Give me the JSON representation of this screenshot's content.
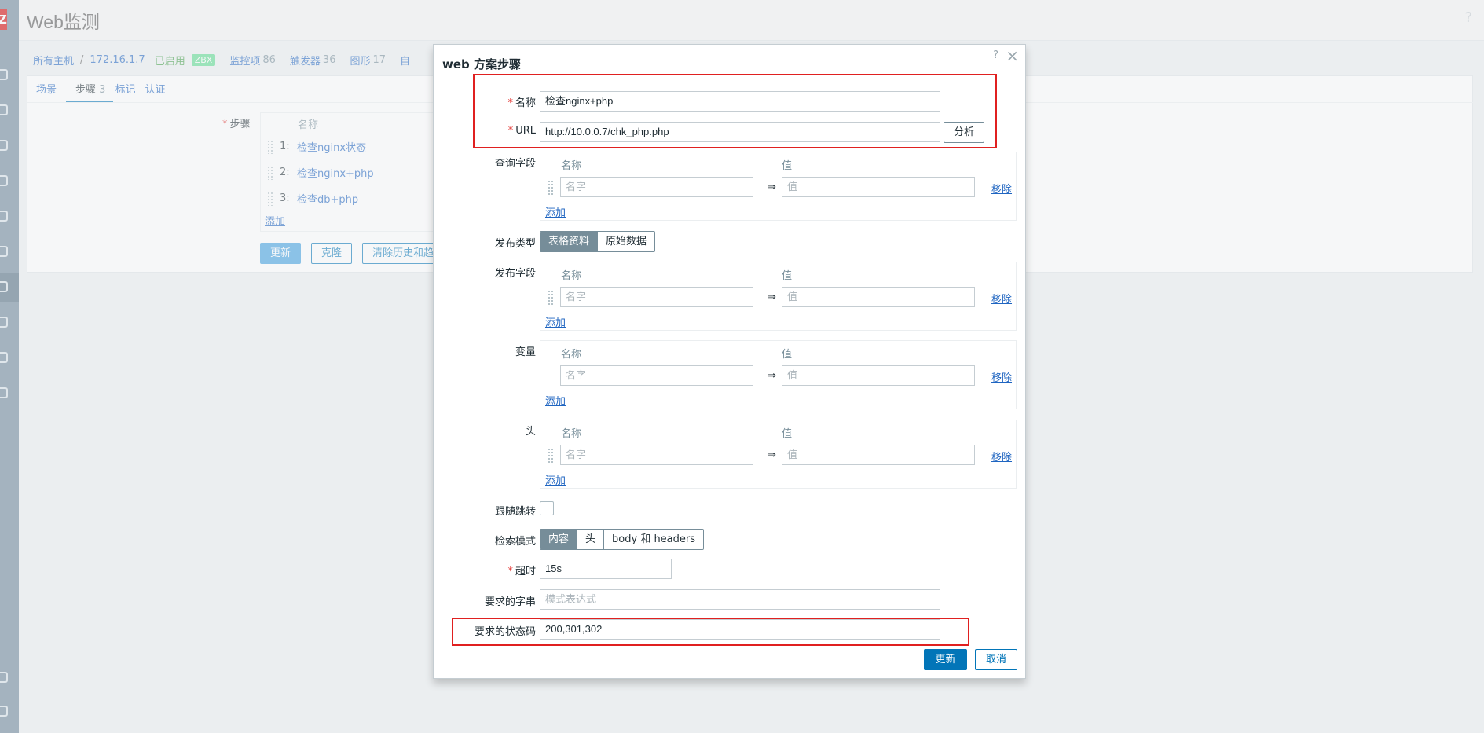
{
  "page": {
    "title": "Web监测",
    "help": "?"
  },
  "breadcrumb": {
    "all_hosts": "所有主机",
    "separator": "/",
    "host": "172.16.1.7",
    "enabled": "已启用",
    "zbx": "ZBX",
    "items_label": "监控项",
    "items_count": "86",
    "triggers_label": "触发器",
    "triggers_count": "36",
    "graphs_label": "图形",
    "graphs_count": "17",
    "more_label": "自"
  },
  "tabs": [
    {
      "label": "场景"
    },
    {
      "label": "步骤",
      "count": "3"
    },
    {
      "label": "标记"
    },
    {
      "label": "认证"
    }
  ],
  "steps": {
    "label": "步骤",
    "column_name": "名称",
    "rows": [
      {
        "num": "1:",
        "name": "检查nginx状态"
      },
      {
        "num": "2:",
        "name": "检查nginx+php"
      },
      {
        "num": "3:",
        "name": "检查db+php"
      }
    ],
    "add": "添加"
  },
  "background_buttons": {
    "update": "更新",
    "clone": "克隆",
    "clear_history": "清除历史和趋"
  },
  "modal": {
    "title": "web 方案步骤",
    "help": "?",
    "close": "×",
    "name_label": "名称",
    "name_value": "检查nginx+php",
    "url_label": "URL",
    "url_value": "http://10.0.0.7/chk_php.php",
    "parse_button": "分析",
    "query_fields_label": "查询字段",
    "post_type_label": "发布类型",
    "post_type_options": [
      "表格资料",
      "原始数据"
    ],
    "post_fields_label": "发布字段",
    "variables_label": "变量",
    "headers_label": "头",
    "table_col_name": "名称",
    "table_col_value": "值",
    "name_placeholder": "名字",
    "value_placeholder": "值",
    "arrow": "⇒",
    "remove": "移除",
    "add": "添加",
    "follow_redirects_label": "跟随跳转",
    "retrieve_mode_label": "检索模式",
    "retrieve_mode_options": [
      "内容",
      "头",
      "body 和 headers"
    ],
    "timeout_label": "超时",
    "timeout_value": "15s",
    "required_string_label": "要求的字串",
    "required_string_placeholder": "模式表达式",
    "status_codes_label": "要求的状态码",
    "status_codes_value": "200,301,302",
    "update_button": "更新",
    "cancel_button": "取消"
  },
  "colors": {
    "highlight": "#e02020",
    "primary": "#0275b8",
    "link": "#1f65c1"
  }
}
